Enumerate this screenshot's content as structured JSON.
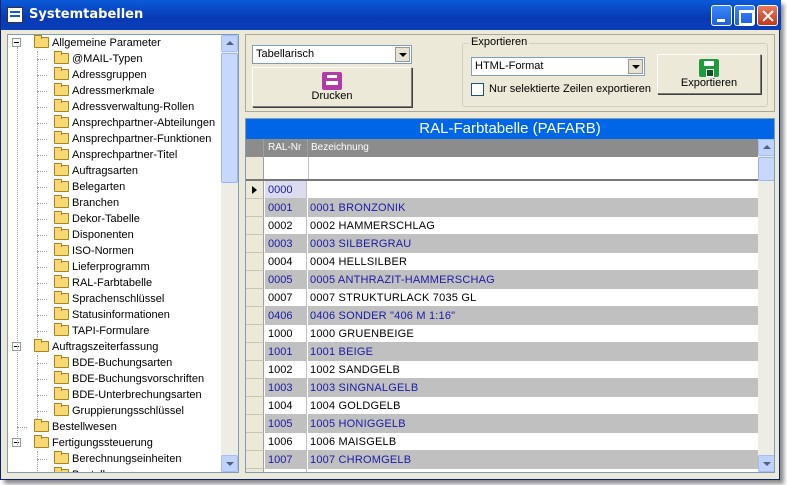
{
  "window": {
    "title": "Systemtabellen"
  },
  "tree": {
    "items": [
      {
        "label": "Allgemeine Parameter",
        "level": 0,
        "expanded": true
      },
      {
        "label": "@MAIL-Typen",
        "level": 1
      },
      {
        "label": "Adressgruppen",
        "level": 1
      },
      {
        "label": "Adressmerkmale",
        "level": 1
      },
      {
        "label": "Adressverwaltung-Rollen",
        "level": 1
      },
      {
        "label": "Ansprechpartner-Abteilungen",
        "level": 1
      },
      {
        "label": "Ansprechpartner-Funktionen",
        "level": 1
      },
      {
        "label": "Ansprechpartner-Titel",
        "level": 1
      },
      {
        "label": "Auftragsarten",
        "level": 1
      },
      {
        "label": "Belegarten",
        "level": 1
      },
      {
        "label": "Branchen",
        "level": 1
      },
      {
        "label": "Dekor-Tabelle",
        "level": 1
      },
      {
        "label": "Disponenten",
        "level": 1
      },
      {
        "label": "ISO-Normen",
        "level": 1
      },
      {
        "label": "Lieferprogramm",
        "level": 1
      },
      {
        "label": "RAL-Farbtabelle",
        "level": 1,
        "selected": true
      },
      {
        "label": "Sprachenschlüssel",
        "level": 1
      },
      {
        "label": "Statusinformationen",
        "level": 1
      },
      {
        "label": "TAPI-Formulare",
        "level": 1
      },
      {
        "label": "Auftragszeiterfassung",
        "level": 0,
        "expanded": true
      },
      {
        "label": "BDE-Buchungsarten",
        "level": 1
      },
      {
        "label": "BDE-Buchungsvorschriften",
        "level": 1
      },
      {
        "label": "BDE-Unterbrechungsarten",
        "level": 1
      },
      {
        "label": "Gruppierungsschlüssel",
        "level": 1
      },
      {
        "label": "Bestellwesen",
        "level": 0
      },
      {
        "label": "Fertigungssteuerung",
        "level": 0,
        "expanded": true
      },
      {
        "label": "Berechnungseinheiten",
        "level": 1
      },
      {
        "label": "Bestellungen",
        "level": 1
      }
    ]
  },
  "toolbar": {
    "view_select": "Tabellarisch",
    "print_label": "Drucken",
    "export_group_label": "Exportieren",
    "export_format": "HTML-Format",
    "only_selected_label": "Nur selektierte Zeilen exportieren",
    "export_button_label": "Exportieren"
  },
  "grid": {
    "title": "RAL-Farbtabelle (PAFARB)",
    "columns": [
      "RAL-Nr",
      "Bezeichnung"
    ],
    "rows": [
      {
        "nr": "0000",
        "bez": "",
        "style": "new"
      },
      {
        "nr": "0001",
        "bez": "0001 BRONZONIK",
        "style": "shaded"
      },
      {
        "nr": "0002",
        "bez": "0002 HAMMERSCHLAG",
        "style": "plain"
      },
      {
        "nr": "0003",
        "bez": "0003 SILBERGRAU",
        "style": "shaded"
      },
      {
        "nr": "0004",
        "bez": "0004 HELLSILBER",
        "style": "plain"
      },
      {
        "nr": "0005",
        "bez": "0005 ANTHRAZIT-HAMMERSCHAG",
        "style": "shaded"
      },
      {
        "nr": "0007",
        "bez": "0007 STRUKTURLACK  7035 GL",
        "style": "plain"
      },
      {
        "nr": "0406",
        "bez": "0406 SONDER \"406 M 1:16\"",
        "style": "shaded"
      },
      {
        "nr": "1000",
        "bez": "1000 GRUENBEIGE",
        "style": "plain"
      },
      {
        "nr": "1001",
        "bez": "1001 BEIGE",
        "style": "shaded"
      },
      {
        "nr": "1002",
        "bez": "1002 SANDGELB",
        "style": "plain"
      },
      {
        "nr": "1003",
        "bez": "1003 SINGNALGELB",
        "style": "shaded"
      },
      {
        "nr": "1004",
        "bez": "1004 GOLDGELB",
        "style": "plain"
      },
      {
        "nr": "1005",
        "bez": "1005 HONIGGELB",
        "style": "shaded"
      },
      {
        "nr": "1006",
        "bez": "1006 MAISGELB",
        "style": "plain"
      },
      {
        "nr": "1007",
        "bez": "1007 CHROMGELB",
        "style": "shaded"
      },
      {
        "nr": "",
        "bez": "",
        "style": "plain"
      }
    ]
  },
  "icons": {
    "app": "table-icon",
    "folder": "folder-icon",
    "print": "print-icon",
    "export": "save-icon"
  },
  "colors": {
    "titlebar": "#0839b5",
    "grid_title": "#0066e8",
    "row_shaded": "#c0c0c0",
    "row_shaded_text": "#1a1aa8"
  }
}
